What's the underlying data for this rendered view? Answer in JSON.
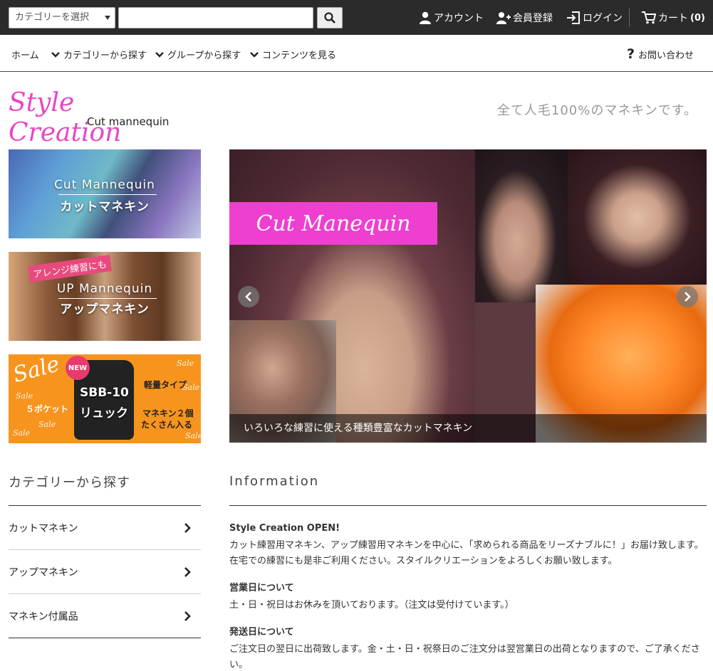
{
  "topbar": {
    "category_select": "カテゴリーを選択",
    "search_placeholder": "",
    "account": "アカウント",
    "register": "会員登録",
    "login": "ログイン",
    "cart": "カート",
    "cart_count": "(0)"
  },
  "nav": {
    "home": "ホーム",
    "category": "カテゴリーから探す",
    "group": "グループから探す",
    "contents": "コンテンツを見る",
    "contact": "お問い合わせ"
  },
  "header": {
    "logo_script": "Style Creation",
    "logo_sub": "Cut mannequin",
    "tagline": "全て人毛100%のマネキンです。"
  },
  "banners": {
    "cut": {
      "en": "Cut Mannequin",
      "jp": "カットマネキン"
    },
    "up": {
      "badge": "アレンジ練習にも",
      "en": "UP Mannequin",
      "jp": "アップマネキン"
    },
    "sale": {
      "sale": "Sale",
      "new": "NEW",
      "type": "軽量タイプ",
      "pockets": "５ポケット",
      "model": "SBB-10",
      "model_jp": "リュック",
      "capacity1": "マネキン２個",
      "capacity2": "たくさん入る"
    }
  },
  "slider": {
    "label": "Cut Manequin",
    "caption": "いろいろな練習に使える種類豊富なカットマネキン"
  },
  "sidebar": {
    "title": "カテゴリーから探す",
    "items": [
      {
        "label": "カットマネキン"
      },
      {
        "label": "アップマネキン"
      },
      {
        "label": "マネキン付属品"
      }
    ]
  },
  "info": {
    "title": "Information",
    "sections": [
      {
        "heading": "Style Creation OPEN!",
        "body": "カット練習用マネキン、アップ練習用マネキンを中心に、「求められる商品をリーズナブルに！」お届け致します。在宅での練習にも是非ご利用ください。スタイルクリエーションをよろしくお願い致します。"
      },
      {
        "heading": "営業日について",
        "body": "土・日・祝日はお休みを頂いております。（注文は受付けています。）"
      },
      {
        "heading": "発送日について",
        "body": "ご注文日の翌日に出荷致します。金・土・日・祝祭日のご注文分は翌営業日の出荷となりますので、ご了承ください。"
      }
    ]
  },
  "colors": {
    "topbar_bg": "#2b2b2b",
    "brand_pink": "#e846c3",
    "slider_label_bg": "#ee3fd0",
    "sale_orange": "#f7941e"
  }
}
